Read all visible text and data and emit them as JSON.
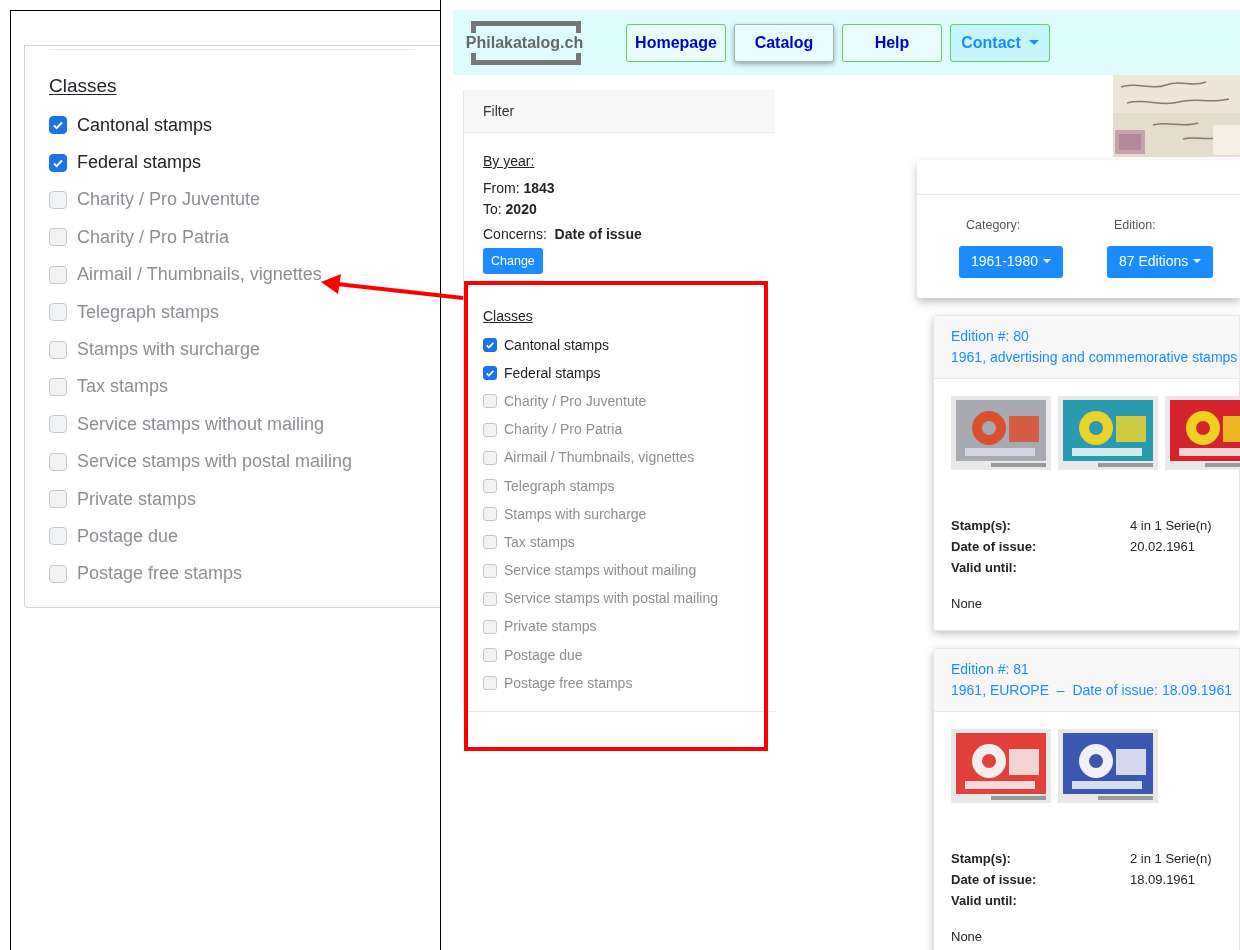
{
  "zoom_panel": {
    "heading": "Classes",
    "classes": [
      {
        "label": "Cantonal stamps",
        "checked": true
      },
      {
        "label": "Federal stamps",
        "checked": true
      },
      {
        "label": "Charity / Pro Juventute",
        "checked": false
      },
      {
        "label": "Charity / Pro Patria",
        "checked": false
      },
      {
        "label": "Airmail / Thumbnails, vignettes",
        "checked": false
      },
      {
        "label": "Telegraph stamps",
        "checked": false
      },
      {
        "label": "Stamps with surcharge",
        "checked": false
      },
      {
        "label": "Tax stamps",
        "checked": false
      },
      {
        "label": "Service stamps without mailing",
        "checked": false
      },
      {
        "label": "Service stamps with postal mailing",
        "checked": false
      },
      {
        "label": "Private stamps",
        "checked": false
      },
      {
        "label": "Postage due",
        "checked": false
      },
      {
        "label": "Postage free stamps",
        "checked": false
      }
    ]
  },
  "navbar": {
    "logo": "Philakatalog.ch",
    "items": [
      {
        "label": "Homepage",
        "selected": false,
        "dropdown": false
      },
      {
        "label": "Catalog",
        "selected": true,
        "dropdown": false
      },
      {
        "label": "Help",
        "selected": false,
        "dropdown": false
      },
      {
        "label": "Contact",
        "selected": false,
        "dropdown": true
      }
    ]
  },
  "filter": {
    "header": "Filter",
    "by_year": "By year:",
    "from_label": "From:",
    "from": "1843",
    "to_label": "To:",
    "to": "2020",
    "concerns_label": "Concerns:",
    "concerns": "Date of issue",
    "button": "Change",
    "classes_heading": "Classes",
    "classes": [
      {
        "label": "Cantonal stamps",
        "checked": true
      },
      {
        "label": "Federal stamps",
        "checked": true
      },
      {
        "label": "Charity / Pro Juventute",
        "checked": false
      },
      {
        "label": "Charity / Pro Patria",
        "checked": false
      },
      {
        "label": "Airmail / Thumbnails, vignettes",
        "checked": false
      },
      {
        "label": "Telegraph stamps",
        "checked": false
      },
      {
        "label": "Stamps with surcharge",
        "checked": false
      },
      {
        "label": "Tax stamps",
        "checked": false
      },
      {
        "label": "Service stamps without mailing",
        "checked": false
      },
      {
        "label": "Service stamps with postal mailing",
        "checked": false
      },
      {
        "label": "Private stamps",
        "checked": false
      },
      {
        "label": "Postage due",
        "checked": false
      },
      {
        "label": "Postage free stamps",
        "checked": false
      }
    ]
  },
  "selector": {
    "fields": [
      {
        "label": "Category:",
        "value": "1961-1980"
      },
      {
        "label": "Edition:",
        "value": "87 Editions"
      }
    ]
  },
  "editions": [
    {
      "number": "Edition #: 80",
      "title": "1961, advertising and commemorative stamps",
      "stamps": [
        {
          "kind": "picture"
        },
        {
          "kind": "picture"
        },
        {
          "kind": "picture"
        }
      ],
      "info": [
        {
          "label": "Stamp(s):",
          "value": "4 in 1 Serie(n)"
        },
        {
          "label": "Date of issue:",
          "value": "20.02.1961"
        },
        {
          "label": "Valid until:"
        }
      ],
      "note": "None"
    },
    {
      "number": "Edition #: 81",
      "title": "1961, EUROPE  –  Date of issue: 18.09.1961",
      "stamps": [
        {
          "kind": "picture"
        },
        {
          "kind": "picture"
        }
      ],
      "info": [
        {
          "label": "Stamp(s):",
          "value": "2 in 1 Serie(n)"
        },
        {
          "label": "Date of issue:",
          "value": "18.09.1961"
        },
        {
          "label": "Valid until:"
        }
      ],
      "note": "None"
    }
  ]
}
